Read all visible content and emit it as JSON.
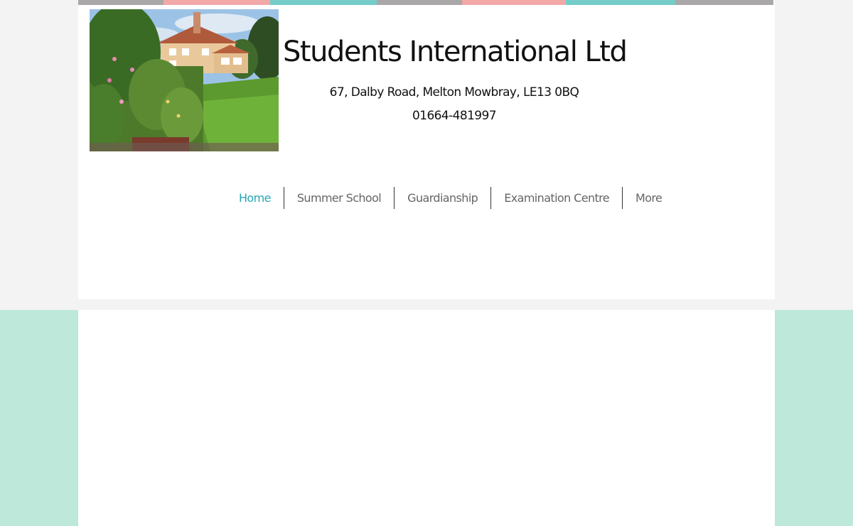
{
  "colors": {
    "page_bg": "#f3f3f3",
    "mint_bg": "#bde8da",
    "panel_bg": "#ffffff",
    "nav_active": "#27a5b4",
    "nav_text": "#666666"
  },
  "strip": {
    "segments": [
      {
        "color": "#a9a7a8",
        "width": 120
      },
      {
        "color": "#f1a8a6",
        "width": 150
      },
      {
        "color": "#75cdca",
        "width": 150
      },
      {
        "color": "#a9a7a8",
        "width": 120
      },
      {
        "color": "#f1a8a6",
        "width": 146
      },
      {
        "color": "#75cdca",
        "width": 154
      },
      {
        "color": "#a9a7a8",
        "width": 138
      }
    ]
  },
  "header": {
    "image_alt": "house-and-garden-photo",
    "title": "Students International Ltd",
    "address": "67, Dalby Road, Melton Mowbray, LE13 0BQ",
    "phone": "01664-481997"
  },
  "nav": {
    "items": [
      {
        "label": "Home",
        "active": true
      },
      {
        "label": "Summer School",
        "active": false
      },
      {
        "label": "Guardianship",
        "active": false
      },
      {
        "label": "Examination Centre",
        "active": false
      },
      {
        "label": "More",
        "active": false
      }
    ]
  }
}
